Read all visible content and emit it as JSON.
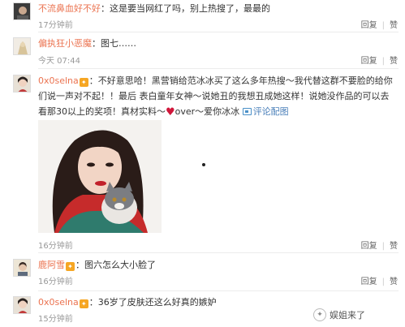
{
  "comments": [
    {
      "username": "不流鼻血好不好",
      "text": "：这是要当网红了吗，别上热搜了，最最的",
      "time": "17分钟前",
      "reply_label": "回复",
      "like_label": "赞"
    },
    {
      "username": "偏执狂小恶魔",
      "text": "：图七……",
      "time": "今天 07:44",
      "reply_label": "回复",
      "like_label": "赞"
    },
    {
      "username": "0x0selna",
      "text_part1": "：不好意思哈！黑营销给范冰冰买了这么多年热搜～我代替这群不要脸的给你们说一声对不起！！最后 表白童年女神～说她丑的我想丑成她这样！说她没作品的可以去看那30以上的奖项！真材实料～",
      "text_part2": "over～爱你冰冰",
      "link_label": "评论配图",
      "time": "16分钟前",
      "reply_label": "回复",
      "like_label": "赞"
    },
    {
      "username": "鹿阿雪",
      "text": "：图六怎么大小脸了",
      "time": "16分钟前",
      "reply_label": "回复",
      "like_label": "赞"
    },
    {
      "username": "0x0selna",
      "text": "：36岁了皮肤还这么好真的嫉妒",
      "time": "15分钟前",
      "reply_label": "回复",
      "like_label": "赞"
    }
  ],
  "watermark": "娱姐来了",
  "colors": {
    "username": "#eb7350",
    "time": "#999999",
    "link": "#4a7fb9",
    "heart": "#d0163a"
  },
  "icons": {
    "badge": "vip-badge-icon",
    "heart": "heart-icon",
    "link": "image-link-icon",
    "watermark": "wechat-logo-icon"
  }
}
